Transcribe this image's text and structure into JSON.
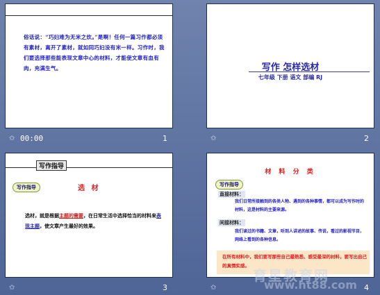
{
  "slides": [
    {
      "number": "1",
      "footer_time": "00:00",
      "body": "俗话说：“巧妇难为无米之炊。”是啊！任何一篇习作都必须有素材，离开了素材，就如同巧妇没有米一样。习作时，我们要选择那些能表现文章中心的材料，才能使文章有血有肉，充满生气。"
    },
    {
      "number": "2",
      "title": "写作  怎样选材",
      "subtitle": "七年级 下册 语文 部编 RJ"
    },
    {
      "number": "3",
      "header": "写作指导",
      "tag": "写作指导",
      "title": "选 材",
      "body_pre": "选材，就是根据",
      "body_red": "主题的需要",
      "body_mid": "，在日常生活中选择恰当的材料来",
      "body_blue": "表现主题",
      "body_post": "，使文章产生最好的效果。"
    },
    {
      "number": "4",
      "title": "材 料 分 类",
      "tag": "写作指导",
      "label1": "直接材料：",
      "text1": "我们日常所接触到的各类人物、遇到的各种事情，都可以成为写作时的材料，这是材料的主要来源。",
      "label2": "间接材料：",
      "text2": "我们读过的书籍、文章，听到人讲述的故事、传说，看过的影视节目，网络上看到的各种信息。",
      "band": "在所有材料中，我们要写那些自己最熟悉、感受最深的材料，要写出自己的真情实感。"
    }
  ],
  "footer_icon": "star-icon",
  "watermark": {
    "text": "育星教育网",
    "url": "www.ht88.com"
  }
}
